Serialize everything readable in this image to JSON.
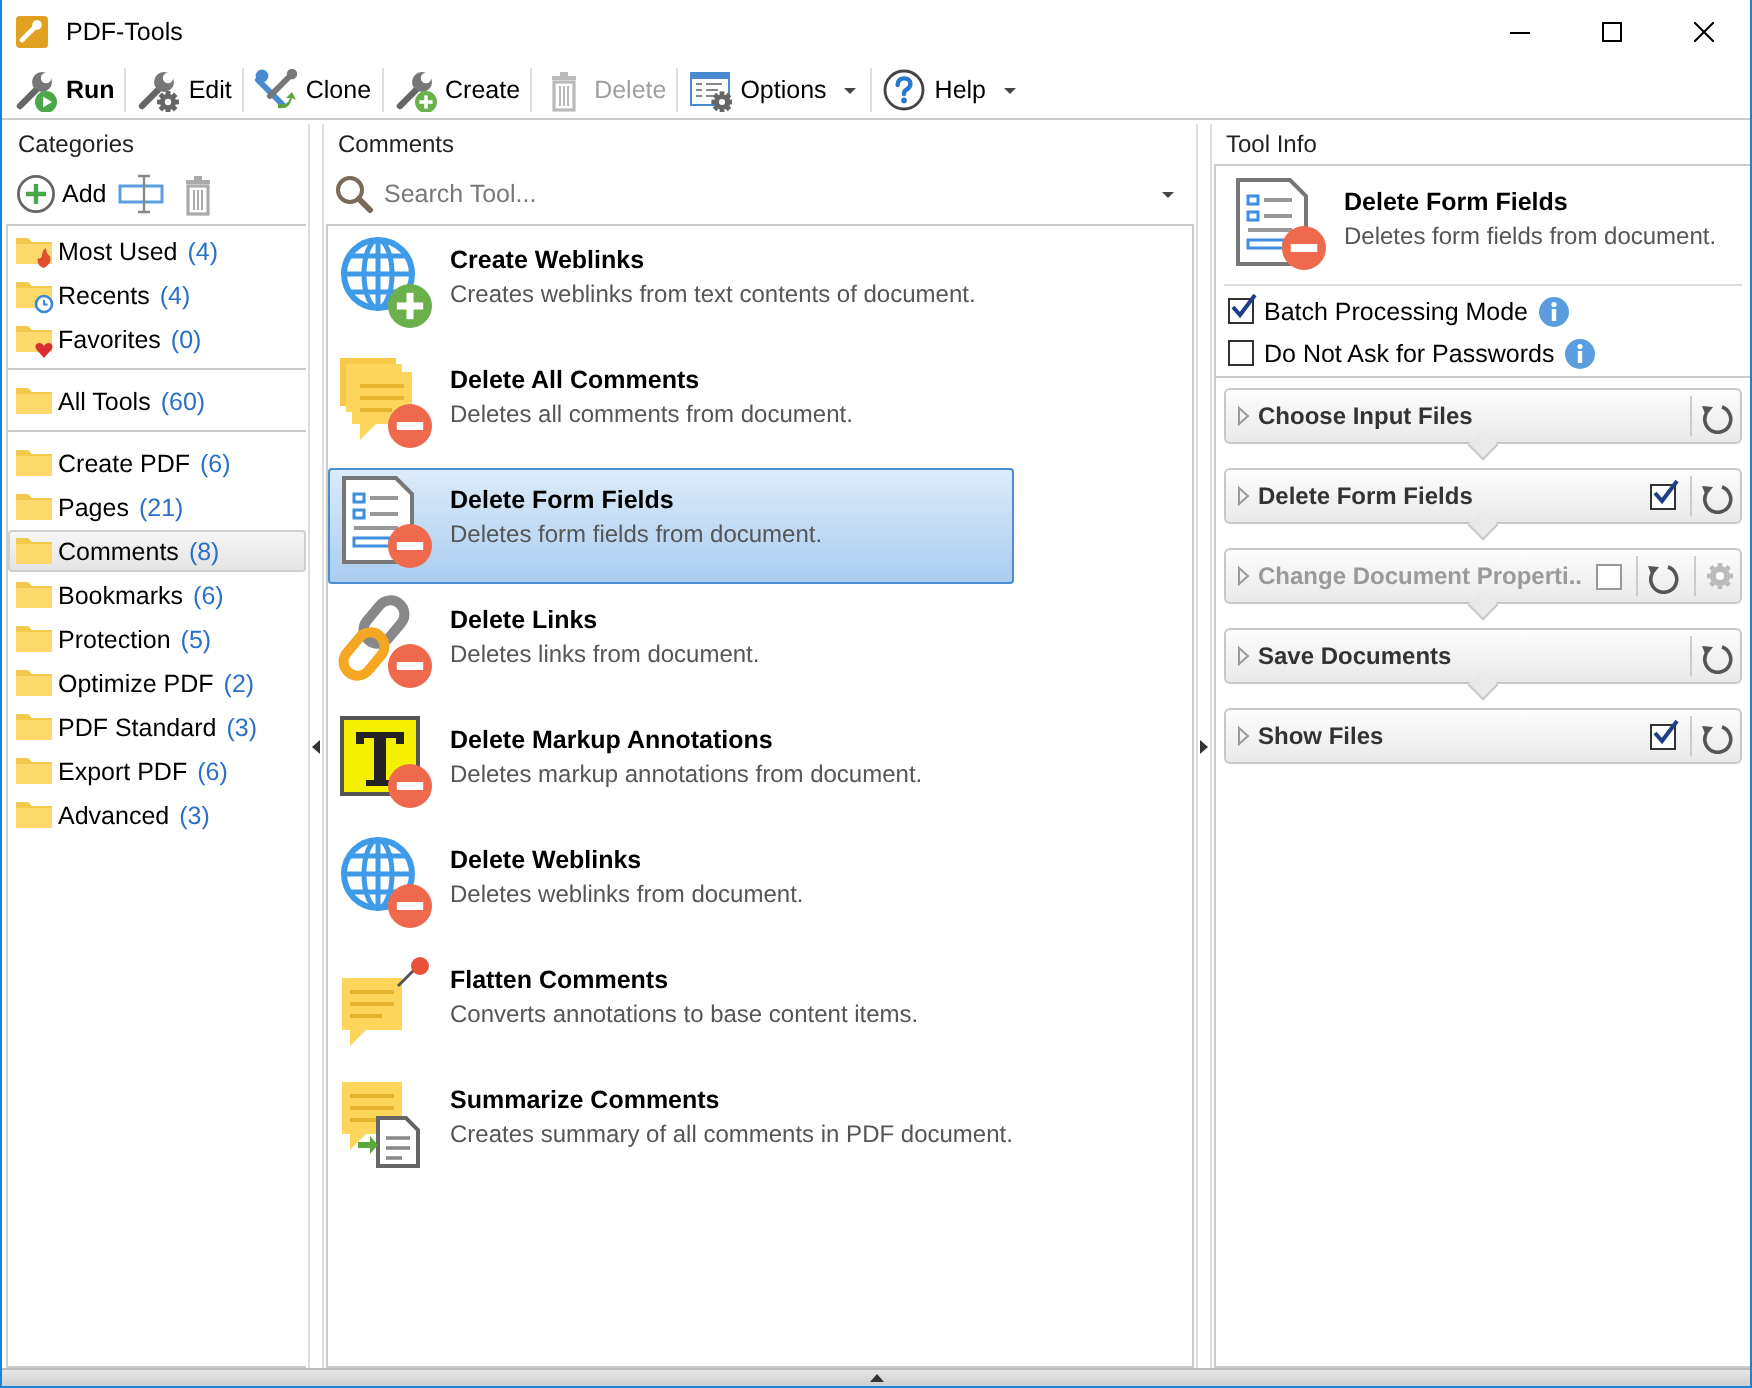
{
  "window": {
    "title": "PDF-Tools"
  },
  "toolbar": [
    {
      "label": "Run",
      "kind": "run",
      "bold": true,
      "disabled": false,
      "dropdown": false
    },
    {
      "label": "Edit",
      "kind": "edit",
      "bold": false,
      "disabled": false,
      "dropdown": false
    },
    {
      "label": "Clone",
      "kind": "clone",
      "bold": false,
      "disabled": false,
      "dropdown": false
    },
    {
      "label": "Create",
      "kind": "create",
      "bold": false,
      "disabled": false,
      "dropdown": false
    },
    {
      "label": "Delete",
      "kind": "delete",
      "bold": false,
      "disabled": true,
      "dropdown": false
    },
    {
      "label": "Options",
      "kind": "options",
      "bold": false,
      "disabled": false,
      "dropdown": true
    },
    {
      "label": "Help",
      "kind": "help",
      "bold": false,
      "disabled": false,
      "dropdown": true
    }
  ],
  "categories": {
    "title": "Categories",
    "add_label": "Add",
    "groups": [
      [
        {
          "label": "Most Used",
          "count": "(4)",
          "kind": "most_used",
          "selected": false
        },
        {
          "label": "Recents",
          "count": "(4)",
          "kind": "recents",
          "selected": false
        },
        {
          "label": "Favorites",
          "count": "(0)",
          "kind": "favorites",
          "selected": false
        }
      ],
      [
        {
          "label": "All Tools",
          "count": "(60)",
          "kind": "folder",
          "selected": false
        }
      ],
      [
        {
          "label": "Create PDF",
          "count": "(6)",
          "kind": "folder",
          "selected": false
        },
        {
          "label": "Pages",
          "count": "(21)",
          "kind": "folder",
          "selected": false
        },
        {
          "label": "Comments",
          "count": "(8)",
          "kind": "folder",
          "selected": true
        },
        {
          "label": "Bookmarks",
          "count": "(6)",
          "kind": "folder",
          "selected": false
        },
        {
          "label": "Protection",
          "count": "(5)",
          "kind": "folder",
          "selected": false
        },
        {
          "label": "Optimize PDF",
          "count": "(2)",
          "kind": "folder",
          "selected": false
        },
        {
          "label": "PDF Standard",
          "count": "(3)",
          "kind": "folder",
          "selected": false
        },
        {
          "label": "Export PDF",
          "count": "(6)",
          "kind": "folder",
          "selected": false
        },
        {
          "label": "Advanced",
          "count": "(3)",
          "kind": "folder",
          "selected": false
        }
      ]
    ]
  },
  "tools": {
    "title": "Comments",
    "search": {
      "placeholder": "Search Tool..."
    },
    "items": [
      {
        "title": "Create Weblinks",
        "description": "Creates weblinks from text contents of document.",
        "kind": "globe_add",
        "selected": false
      },
      {
        "title": "Delete All Comments",
        "description": "Deletes all comments from document.",
        "kind": "comments_remove",
        "selected": false
      },
      {
        "title": "Delete Form Fields",
        "description": "Deletes form fields from document.",
        "kind": "form_remove",
        "selected": true
      },
      {
        "title": "Delete Links",
        "description": "Deletes links from document.",
        "kind": "link_remove",
        "selected": false
      },
      {
        "title": "Delete Markup Annotations",
        "description": "Deletes markup annotations from document.",
        "kind": "markup_remove",
        "selected": false
      },
      {
        "title": "Delete Weblinks",
        "description": "Deletes weblinks from document.",
        "kind": "globe_remove",
        "selected": false
      },
      {
        "title": "Flatten Comments",
        "description": "Converts annotations to base content items.",
        "kind": "note_pin",
        "selected": false
      },
      {
        "title": "Summarize Comments",
        "description": "Creates summary of all comments in PDF document.",
        "kind": "note_doc",
        "selected": false
      }
    ]
  },
  "tool_info": {
    "title": "Tool Info",
    "tool": {
      "title": "Delete Form Fields",
      "description": "Deletes form fields from document.",
      "kind": "form_remove"
    },
    "options": [
      {
        "label": "Batch Processing Mode",
        "checked": true
      },
      {
        "label": "Do Not Ask for Passwords",
        "checked": false
      }
    ],
    "steps": [
      {
        "label": "Choose Input Files",
        "kind": "plain",
        "disabled": false
      },
      {
        "label": "Delete Form Fields",
        "kind": "check",
        "checked": true,
        "disabled": false
      },
      {
        "label": "Change Document Properti..",
        "kind": "check_settings",
        "checked": false,
        "disabled": true
      },
      {
        "label": "Save Documents",
        "kind": "plain",
        "disabled": false
      },
      {
        "label": "Show Files",
        "kind": "check",
        "checked": true,
        "disabled": false
      }
    ]
  }
}
